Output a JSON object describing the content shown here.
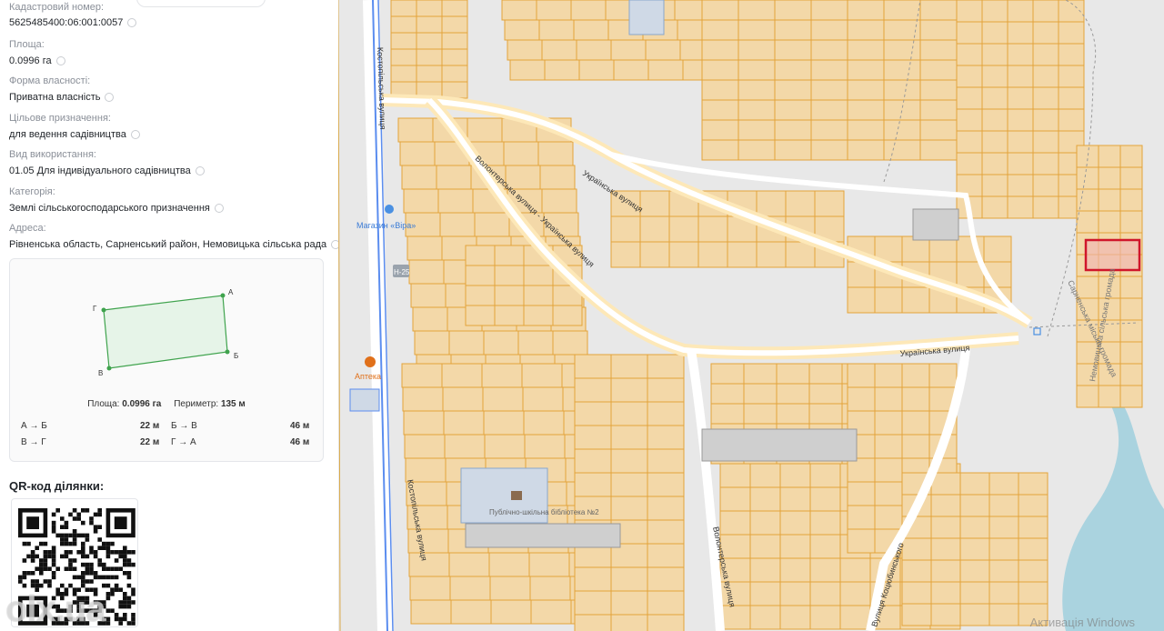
{
  "panel": {
    "fields": [
      {
        "label": "Кадастровий номер:",
        "value": "5625485400:06:001:0057"
      },
      {
        "label": "Площа:",
        "value": "0.0996 га"
      },
      {
        "label": "Форма власності:",
        "value": "Приватна власність"
      },
      {
        "label": "Цільове призначення:",
        "value": "для ведення садівництва"
      },
      {
        "label": "Вид використання:",
        "value": "01.05 Для індивідуального садівництва"
      },
      {
        "label": "Категорія:",
        "value": "Землі сільськогосподарського призначення"
      },
      {
        "label": "Адреса:",
        "value": "Рівненська область, Сарненський район, Немовицька сільська рада"
      }
    ],
    "shape": {
      "vertices": [
        "А",
        "Б",
        "В",
        "Г"
      ],
      "area_label": "Площа:",
      "area_value": "0.0996 га",
      "perimeter_label": "Периметр:",
      "perimeter_value": "135 м",
      "sides": [
        {
          "name": "А → Б",
          "length": "22 м"
        },
        {
          "name": "Б → В",
          "length": "46 м"
        },
        {
          "name": "В → Г",
          "length": "22 м"
        },
        {
          "name": "Г → А",
          "length": "46 м"
        }
      ]
    },
    "qr_title": "QR-код ділянки:",
    "watermark": "olx.ua"
  },
  "map": {
    "labels": {
      "kostopil_street": "Костопільська вулиця",
      "ukrainska_1": "Українська вулиця",
      "ukrainska_2": "Українська вулиця",
      "volonterska_ukrainska": "Волонтерська вулиця - Українська вулиця",
      "volonterska": "Волонтерська вулиця",
      "kotsiubynskoho": "Вулиця Коцюбинського",
      "sarnenska_hromada": "Сарненська міська громада",
      "nemovytska_hromada": "Немовицька сільська громада",
      "road": "Н-25",
      "shop": "Магазин «Віра»",
      "pharmacy": "Аптека",
      "library": "Публічно-шкільна бібліотека №2"
    },
    "activation": "Активація Windows"
  },
  "colors": {
    "parcel_fill": "#f3d8a8",
    "parcel_stroke": "#e3a33a",
    "road": "#ffffff",
    "road_glow": "#fde8b8",
    "main_road": "#5b8def",
    "water": "#aad3df",
    "selected": "#d0162b",
    "shape_fill": "#e6f4e8",
    "shape_stroke": "#3fa34d"
  }
}
